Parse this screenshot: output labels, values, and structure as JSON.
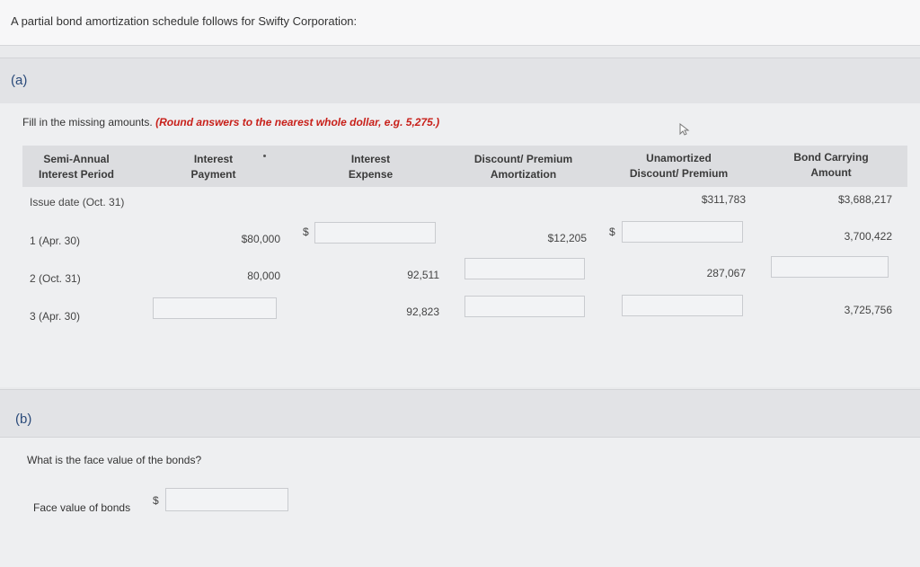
{
  "intro": "A partial bond amortization schedule follows for Swifty Corporation:",
  "part_a": {
    "label": "(a)",
    "instruction": "Fill in the missing amounts.",
    "instruction_note": "(Round answers to the nearest whole dollar, e.g. 5,275.)",
    "headers": {
      "period": [
        "Semi-Annual",
        "Interest Period"
      ],
      "payment": [
        "Interest",
        "Payment"
      ],
      "expense": [
        "Interest",
        "Expense"
      ],
      "amortization": [
        "Discount/ Premium",
        "Amortization"
      ],
      "unamortized": [
        "Unamortized",
        "Discount/ Premium"
      ],
      "carrying": [
        "Bond Carrying",
        "Amount"
      ]
    },
    "rows": [
      {
        "period": "Issue date (Oct. 31)",
        "unamortized": "$311,783",
        "carrying": "$3,688,217"
      },
      {
        "period": "1 (Apr. 30)",
        "payment": "$80,000",
        "expense_currency": "$",
        "amortization": "$12,205",
        "unamortized_currency": "$",
        "carrying": "3,700,422"
      },
      {
        "period": "2 (Oct. 31)",
        "payment": "80,000",
        "expense": "92,511",
        "unamortized": "287,067"
      },
      {
        "period": "3 (Apr. 30)",
        "expense": "92,823",
        "carrying": "3,725,756"
      }
    ]
  },
  "part_b": {
    "label": "(b)",
    "question": "What is the face value of the bonds?",
    "field_label": "Face value of bonds",
    "currency": "$"
  }
}
